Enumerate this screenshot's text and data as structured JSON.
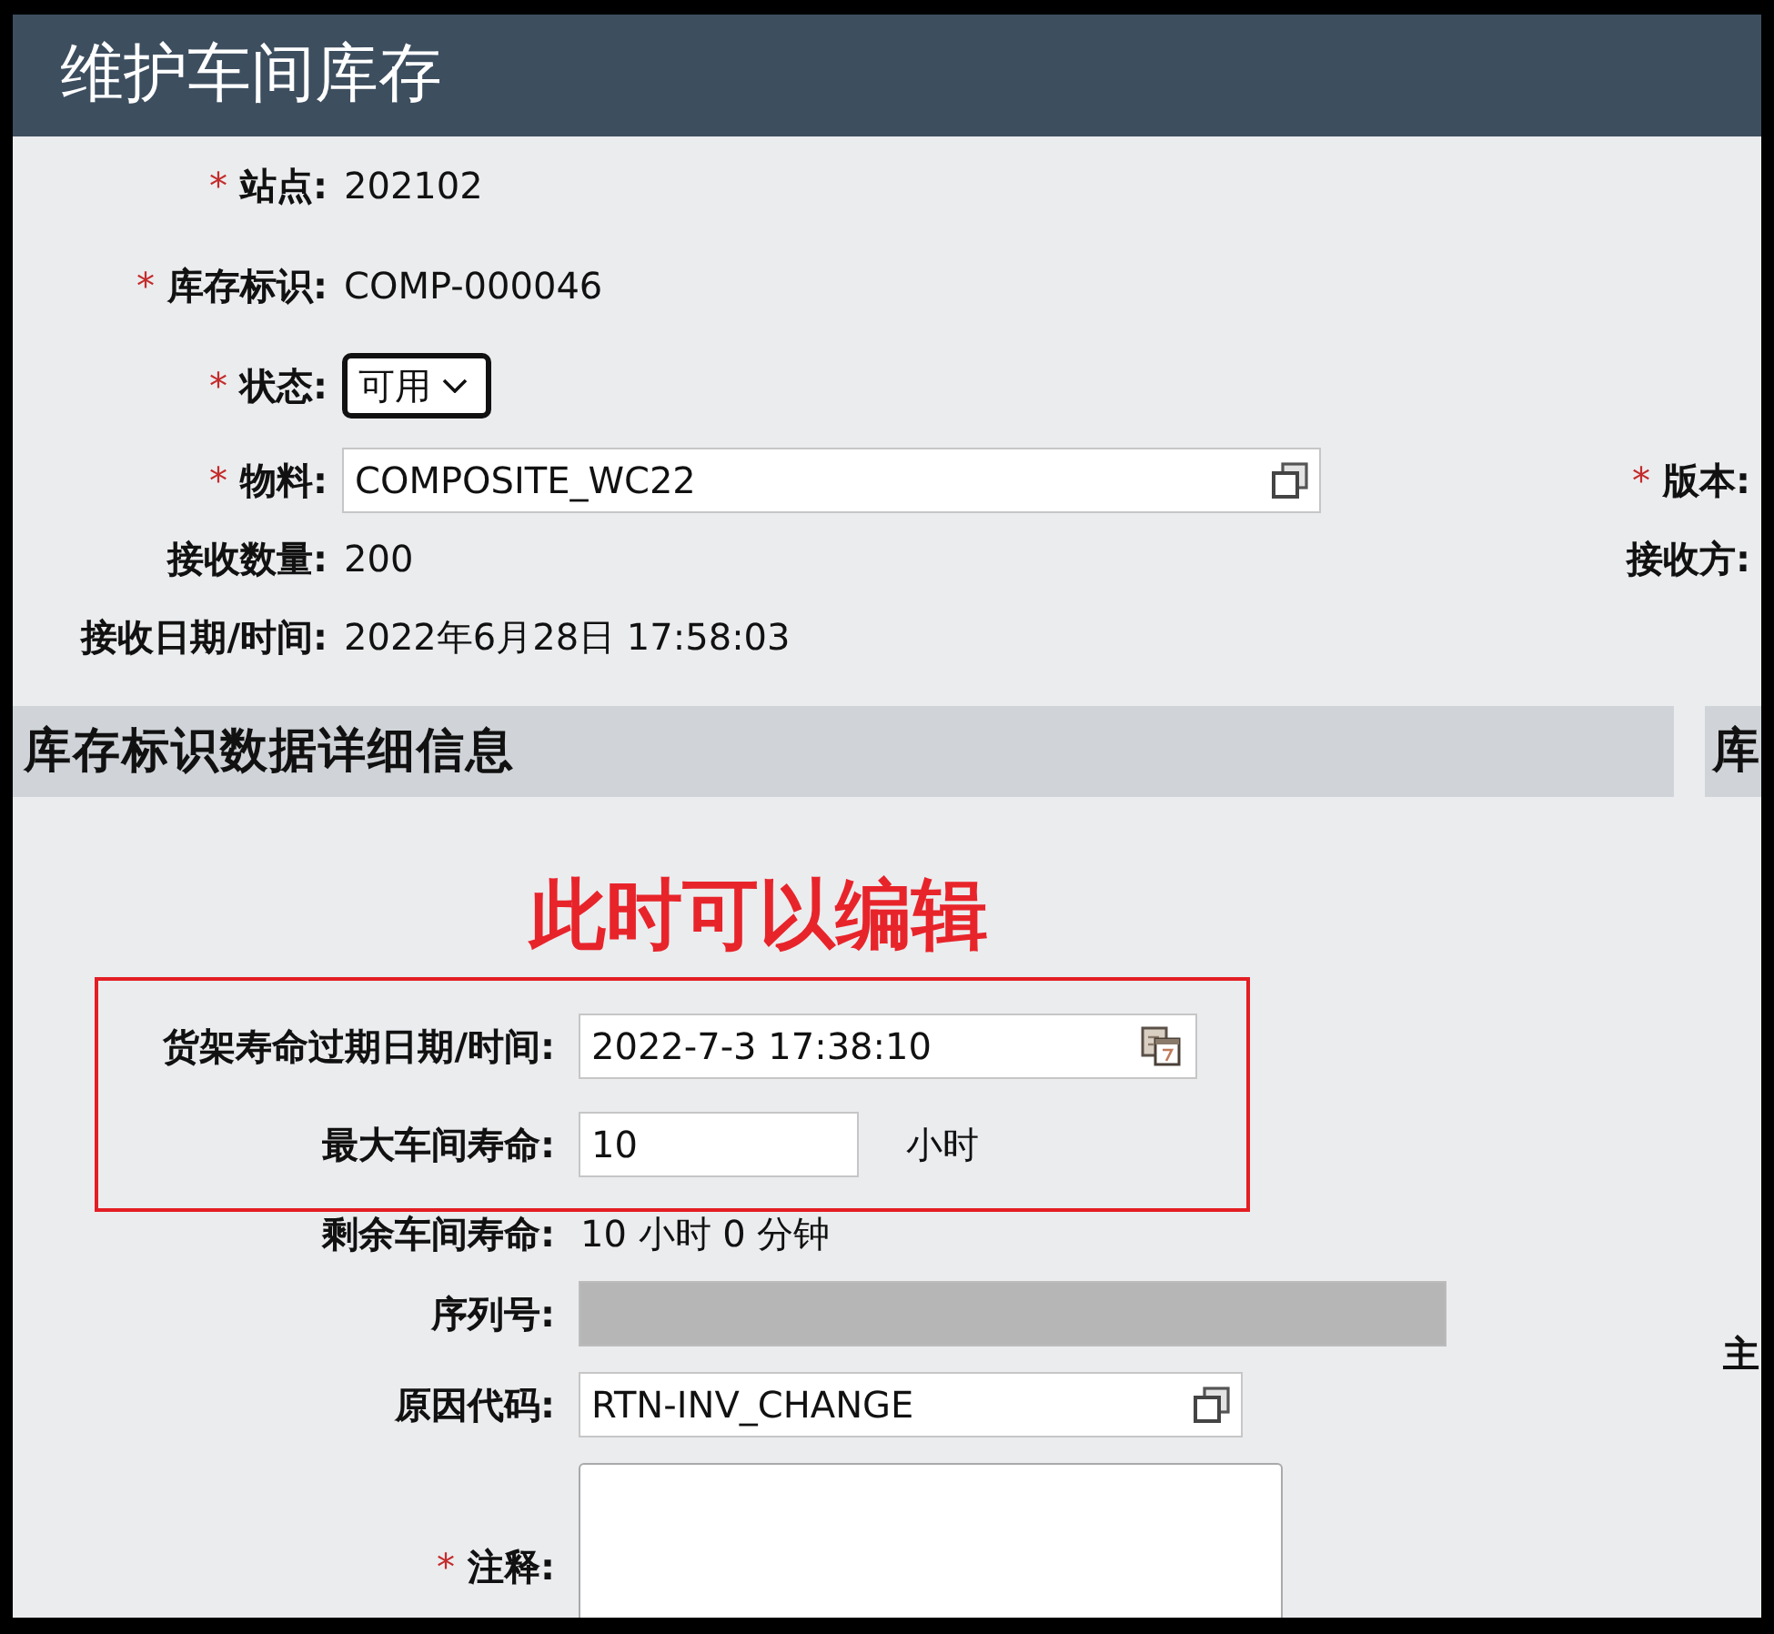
{
  "header": {
    "title": "维护车间库存"
  },
  "general": [
    {
      "mark": "*",
      "label": "站点:",
      "kind": "text",
      "value": "202102"
    },
    {
      "mark": "*",
      "label": "库存标识:",
      "kind": "text",
      "value": "COMP-000046"
    },
    {
      "mark": "*",
      "label": "状态:",
      "kind": "select",
      "value": "可用"
    }
  ],
  "receipt": [
    {
      "mark": "*",
      "label": "物料:",
      "kind": "lookup",
      "value": "COMPOSITE_WC22",
      "side": {
        "mark": "*",
        "label": "版本:"
      }
    },
    {
      "label": "接收数量:",
      "kind": "text",
      "value": "200",
      "side": {
        "label": "接收方:"
      }
    },
    {
      "label": "接收日期/时间:",
      "kind": "text",
      "value": "2022年6月28日 17:58:03"
    }
  ],
  "detail_section": {
    "title": "库存标识数据详细信息"
  },
  "annotation": {
    "text": "此时可以编辑"
  },
  "highlighted_fields": [
    {
      "label": "货架寿命过期日期/时间:",
      "kind": "date",
      "value": "2022-7-3 17:38:10"
    },
    {
      "label": "最大车间寿命:",
      "kind": "input",
      "value": "10",
      "disabled": false,
      "unit": "小时"
    }
  ],
  "detail_fields": [
    {
      "label": "剩余车间寿命:",
      "kind": "text",
      "value": "10 小时 0 分钟"
    },
    {
      "label": "序列号:",
      "kind": "input",
      "disabled": true
    },
    {
      "label": "原因代码:",
      "kind": "lookup",
      "value": "RTN-INV_CHANGE"
    },
    {
      "mark": "*",
      "label": "注释:",
      "kind": "textarea"
    }
  ],
  "side_panel": {
    "title": "库",
    "label": "主"
  }
}
